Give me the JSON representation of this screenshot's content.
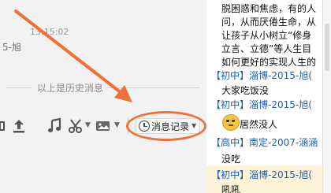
{
  "chat": {
    "timestamp": "13:15:02",
    "sender": "5-旭",
    "history_divider": "以上是历史消息",
    "toolbar": {
      "history_button_label": "消息记录"
    }
  },
  "messages_panel": {
    "paragraph_lines": [
      "脱困惑和焦虑，有的人",
      "问，从而厌倦生命，从",
      "让孩子从小树立“修身",
      "立言、立德”等人生目",
      "如何更好的实现人生的"
    ],
    "messages": [
      {
        "tag": "【初中】淄博-2015-旭(",
        "text": "大家吃饭没"
      },
      {
        "tag": "【初中】淄博-2015-旭(",
        "text": "居然没人"
      },
      {
        "tag": "【高中】南定-2007-涵涵",
        "text": "没吃"
      },
      {
        "tag": "【初中】淄博-2015-旭(",
        "text": "吼吼"
      }
    ]
  },
  "colors": {
    "annotation": "#f07038",
    "tag_blue": "#1a5fb4",
    "highlight_row": "#fcf3d9"
  }
}
